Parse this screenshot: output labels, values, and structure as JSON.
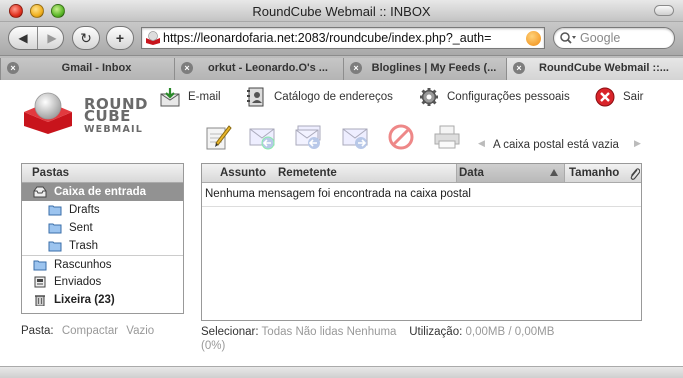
{
  "window": {
    "title": "RoundCube Webmail :: INBOX"
  },
  "toolbar": {
    "back_label": "◀",
    "forward_label": "▶",
    "reload_label": "↻",
    "addtab_label": "+",
    "url": "https://leonardofaria.net:2083/roundcube/index.php?_auth=",
    "search_placeholder": "Google"
  },
  "tabs": [
    {
      "label": "Gmail - Inbox",
      "active": false
    },
    {
      "label": "orkut - Leonardo.O's ...",
      "active": false
    },
    {
      "label": "Bloglines | My Feeds (...",
      "active": false
    },
    {
      "label": "RoundCube Webmail ::...",
      "active": true
    }
  ],
  "logo": {
    "line1": "ROUND",
    "line2": "CUBE",
    "line3": "WEBMAIL"
  },
  "topnav": {
    "email": "E-mail",
    "addressbook": "Catálogo de endereços",
    "settings": "Configurações pessoais",
    "logout": "Sair"
  },
  "mailbox_status": "A caixa postal está vazia",
  "folders": {
    "header": "Pastas",
    "items": [
      {
        "label": "Caixa de entrada",
        "selected": true
      },
      {
        "label": "Drafts"
      },
      {
        "label": "Sent"
      },
      {
        "label": "Trash"
      },
      {
        "label": "Rascunhos"
      },
      {
        "label": "Enviados"
      },
      {
        "label": "Lixeira (23)"
      }
    ]
  },
  "messagelist": {
    "columns": {
      "subject": "Assunto",
      "from": "Remetente",
      "date": "Data",
      "size": "Tamanho"
    },
    "empty_text": "Nenhuma mensagem foi encontrada na caixa postal"
  },
  "footer_left": {
    "label": "Pasta:",
    "compact": "Compactar",
    "empty": "Vazio"
  },
  "footer_right": {
    "select_label": "Selecionar:",
    "all": "Todas",
    "unread": "Não lidas",
    "none": "Nenhuma",
    "usage_label": "Utilização:",
    "usage_value": "0,00MB / 0,00MB",
    "usage_percent": "(0%)"
  }
}
